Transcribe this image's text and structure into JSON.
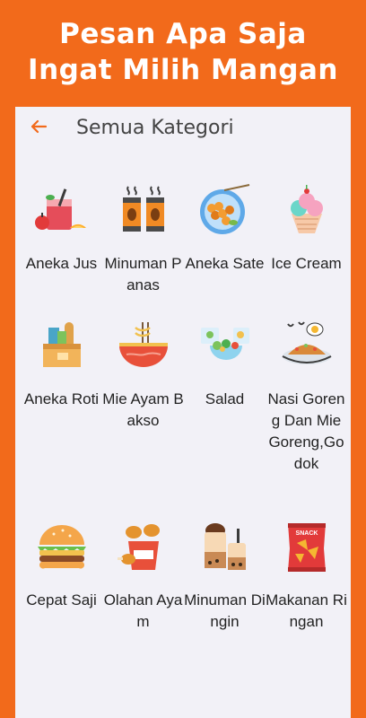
{
  "promo": {
    "line1": "Pesan Apa Saja",
    "line2": "Ingat Milih Mangan"
  },
  "appbar": {
    "back_icon": "arrow-left-icon",
    "title": "Semua Kategori"
  },
  "categories": [
    {
      "label": "Aneka Jus",
      "icon": "juice-icon"
    },
    {
      "label": "Minuman Panas",
      "icon": "hot-drink-icon"
    },
    {
      "label": "Aneka Sate",
      "icon": "satay-icon"
    },
    {
      "label": "Ice Cream",
      "icon": "ice-cream-icon"
    },
    {
      "label": "Aneka Roti",
      "icon": "bread-icon"
    },
    {
      "label": "Mie Ayam Bakso",
      "icon": "noodle-icon"
    },
    {
      "label": "Salad",
      "icon": "salad-icon"
    },
    {
      "label": "Nasi Goreng Dan Mie Goreng,Godok",
      "icon": "fried-rice-icon"
    },
    {
      "label": "Cepat Saji",
      "icon": "burger-icon"
    },
    {
      "label": "Olahan Ayam",
      "icon": "fried-chicken-icon"
    },
    {
      "label": "Minuman Dingin",
      "icon": "cold-drink-icon"
    },
    {
      "label": "Makanan Ringan",
      "icon": "snack-icon"
    }
  ],
  "colors": {
    "accent": "#F26A1B",
    "background": "#F2F1F7"
  }
}
